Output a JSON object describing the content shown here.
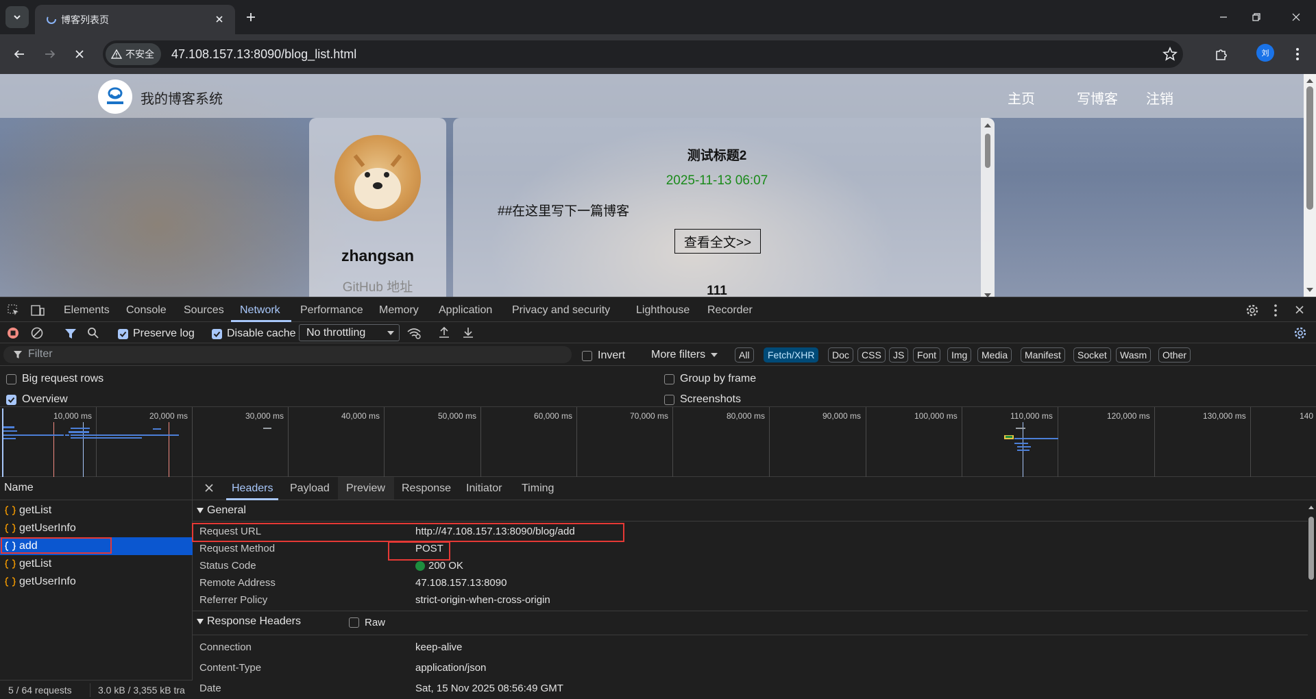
{
  "browser": {
    "tab_title": "博客列表页",
    "not_secure_label": "不安全",
    "url": "47.108.157.13:8090/blog_list.html",
    "profile_initial": "刘"
  },
  "page": {
    "site_title": "我的博客系统",
    "nav_links": [
      "主页",
      "写博客",
      "注销"
    ],
    "user": {
      "name": "zhangsan",
      "github": "GitHub 地址"
    },
    "blogs": [
      {
        "title": "测试标题2",
        "date": "2025-11-13 06:07",
        "desc": "##在这里写下一篇博客",
        "read_more": "查看全文>>"
      },
      {
        "title": "111"
      }
    ]
  },
  "devtools": {
    "tabs": [
      "Elements",
      "Console",
      "Sources",
      "Network",
      "Performance",
      "Memory",
      "Application",
      "Privacy and security",
      "Lighthouse",
      "Recorder"
    ],
    "active_tab": "Network",
    "preserve_log": "Preserve log",
    "disable_cache": "Disable cache",
    "throttling": "No throttling",
    "filter_placeholder": "Filter",
    "invert": "Invert",
    "more_filters": "More filters",
    "type_filters": [
      "All",
      "Fetch/XHR",
      "Doc",
      "CSS",
      "JS",
      "Font",
      "Img",
      "Media",
      "Manifest",
      "Socket",
      "Wasm",
      "Other"
    ],
    "active_type_filter": "Fetch/XHR",
    "options": {
      "big_request_rows": "Big request rows",
      "overview": "Overview",
      "group_by_frame": "Group by frame",
      "screenshots": "Screenshots"
    },
    "overview_ticks": [
      "10,000 ms",
      "20,000 ms",
      "30,000 ms",
      "40,000 ms",
      "50,000 ms",
      "60,000 ms",
      "70,000 ms",
      "80,000 ms",
      "90,000 ms",
      "100,000 ms",
      "110,000 ms",
      "120,000 ms",
      "130,000 ms",
      "140"
    ],
    "name_column": "Name",
    "requests": [
      "getList",
      "getUserInfo",
      "add",
      "getList",
      "getUserInfo"
    ],
    "selected_request": "add",
    "footer": {
      "requests": "5 / 64 requests",
      "transfer": "3.0 kB / 3,355 kB tra"
    },
    "detail_tabs": [
      "Headers",
      "Payload",
      "Preview",
      "Response",
      "Initiator",
      "Timing"
    ],
    "active_detail_tab": "Headers",
    "general_title": "General",
    "general": [
      {
        "key": "Request URL",
        "value": "http://47.108.157.13:8090/blog/add"
      },
      {
        "key": "Request Method",
        "value": "POST"
      },
      {
        "key": "Status Code",
        "value": "200 OK"
      },
      {
        "key": "Remote Address",
        "value": "47.108.157.13:8090"
      },
      {
        "key": "Referrer Policy",
        "value": "strict-origin-when-cross-origin"
      }
    ],
    "response_headers_title": "Response Headers",
    "raw_label": "Raw",
    "response_headers": [
      {
        "key": "Connection",
        "value": "keep-alive"
      },
      {
        "key": "Content-Type",
        "value": "application/json"
      },
      {
        "key": "Date",
        "value": "Sat, 15 Nov 2025 08:56:49 GMT"
      }
    ]
  },
  "colors": {
    "accent": "#a8c7fa",
    "selected_row": "#0b57d0",
    "status_ok": "#1e8e3e",
    "highlight": "#e53935",
    "date_green": "#1a8a1a"
  }
}
